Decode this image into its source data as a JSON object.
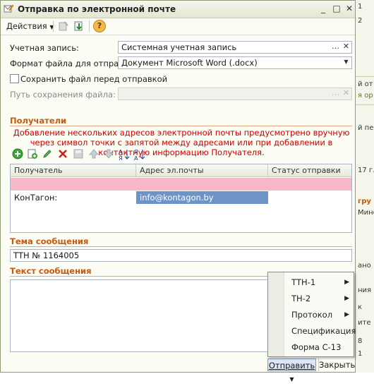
{
  "background_window": {
    "fragments": [
      "1",
      "2",
      "й от",
      "я ор",
      "й пер",
      "17 г.",
      "гру",
      "Мино",
      "ано",
      "ния",
      "к",
      "ите",
      "8",
      "1"
    ]
  },
  "dialog": {
    "title": "Отправка по электронной почте",
    "window_buttons": {
      "minimize": "_",
      "maximize": "□",
      "close": "✕"
    },
    "toolbar": {
      "actions_label": "Действия",
      "help": "?"
    },
    "account_label": "Учетная запись:",
    "account_value": "Системная учетная запись",
    "format_label": "Формат файла для отправки:",
    "format_value": "Документ Microsoft Word (.docx)",
    "save_checkbox_label": "Сохранить файл перед отправкой",
    "save_checkbox_checked": false,
    "path_label": "Путь сохранения файла:",
    "path_value": "",
    "recipients_title": "Получатели",
    "recipients_notice": "Добавление нескольких адресов электронной почты предусмотрено вручную через символ точки с запятой между адресами или при добавлении в контактную информацию Получателя.",
    "grid": {
      "columns": [
        "Получатель",
        "Адрес эл.почты",
        "Статус отправки"
      ],
      "rows": [
        {
          "recipient": "КонТагон:",
          "email": "info@kontagon.by",
          "status": ""
        }
      ]
    },
    "subject_title": "Тема сообщения",
    "subject_value": "ТТН № 1164005",
    "body_title": "Текст сообщения",
    "body_value": "",
    "send_button": "Отправить",
    "close_button": "Закрыть",
    "menu": [
      {
        "label": "ТТН-1",
        "submenu": true
      },
      {
        "label": "ТН-2",
        "submenu": true
      },
      {
        "label": "Протокол",
        "submenu": true
      },
      {
        "label": "Спецификация",
        "submenu": false
      },
      {
        "label": "Форма С-13",
        "submenu": false
      }
    ],
    "colors": {
      "accent": "#c55a11",
      "notice": "#d10000",
      "row_highlight": "#f6b7c8",
      "cell_selected": "#6e93c7"
    }
  }
}
